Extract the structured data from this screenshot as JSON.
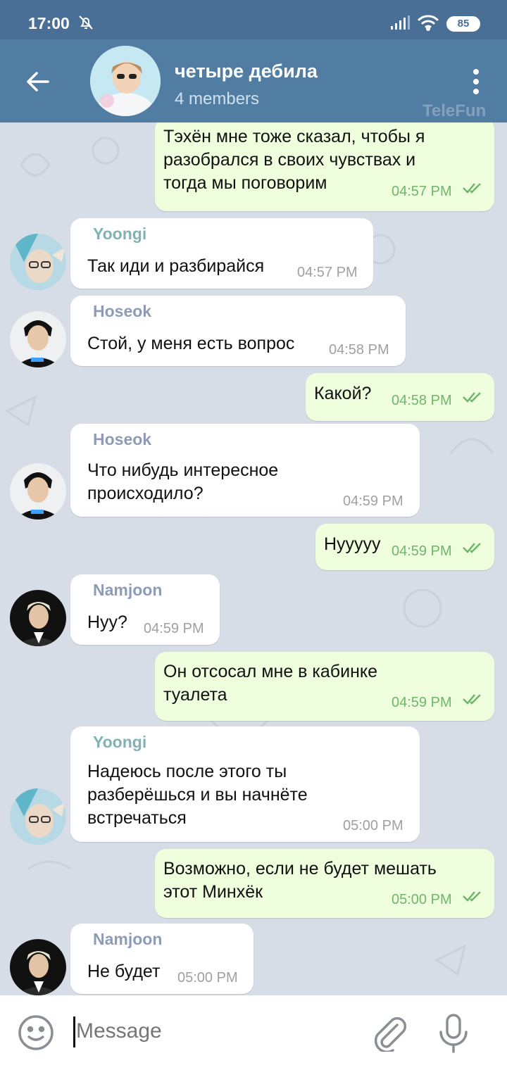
{
  "status": {
    "time": "17:00",
    "battery": "85"
  },
  "header": {
    "title": "четыре дебила",
    "subtitle": "4 members",
    "watermark": "TeleFun"
  },
  "messages": [
    {
      "dir": "out",
      "lines": [
        "Тэхён мне тоже сказал, чтобы я",
        "разобрался в своих чувствах и",
        "тогда мы поговорим"
      ],
      "time": "04:57 PM"
    },
    {
      "dir": "in",
      "sender": "Yoongi",
      "text": "Так иди и разбирайся",
      "time": "04:57 PM"
    },
    {
      "dir": "in",
      "sender": "Hoseok",
      "text": "Стой, у меня есть вопрос",
      "time": "04:58 PM"
    },
    {
      "dir": "out",
      "lines": [
        "Какой?"
      ],
      "time": "04:58 PM"
    },
    {
      "dir": "in",
      "sender": "Hoseok",
      "lines": [
        "Что нибудь интересное",
        "происходило?"
      ],
      "time": "04:59 PM"
    },
    {
      "dir": "out",
      "lines": [
        "Нуууyy"
      ],
      "time": "04:59 PM"
    },
    {
      "dir": "in",
      "sender": "Namjoon",
      "text": "Нуу?",
      "time": "04:59 PM"
    },
    {
      "dir": "out",
      "lines": [
        "Он отсосал мне в кабинке",
        "туалета"
      ],
      "time": "04:59 PM"
    },
    {
      "dir": "in",
      "sender": "Yoongi",
      "lines": [
        "Надеюсь после этого ты",
        "разберёшься и вы начнёте",
        "встречаться"
      ],
      "time": "05:00 PM"
    },
    {
      "dir": "out",
      "lines": [
        "Возможно, если не будет мешать",
        "этот Минхёк"
      ],
      "time": "05:00 PM"
    },
    {
      "dir": "in",
      "sender": "Namjoon",
      "text": "Не будет",
      "time": "05:00 PM"
    }
  ],
  "input": {
    "placeholder": "Message"
  },
  "colors": {
    "header": "#517da2",
    "statusbar": "#4a6f96",
    "bubble_out": "#effedd",
    "bubble_in": "#ffffff",
    "check": "#6fb66b"
  }
}
